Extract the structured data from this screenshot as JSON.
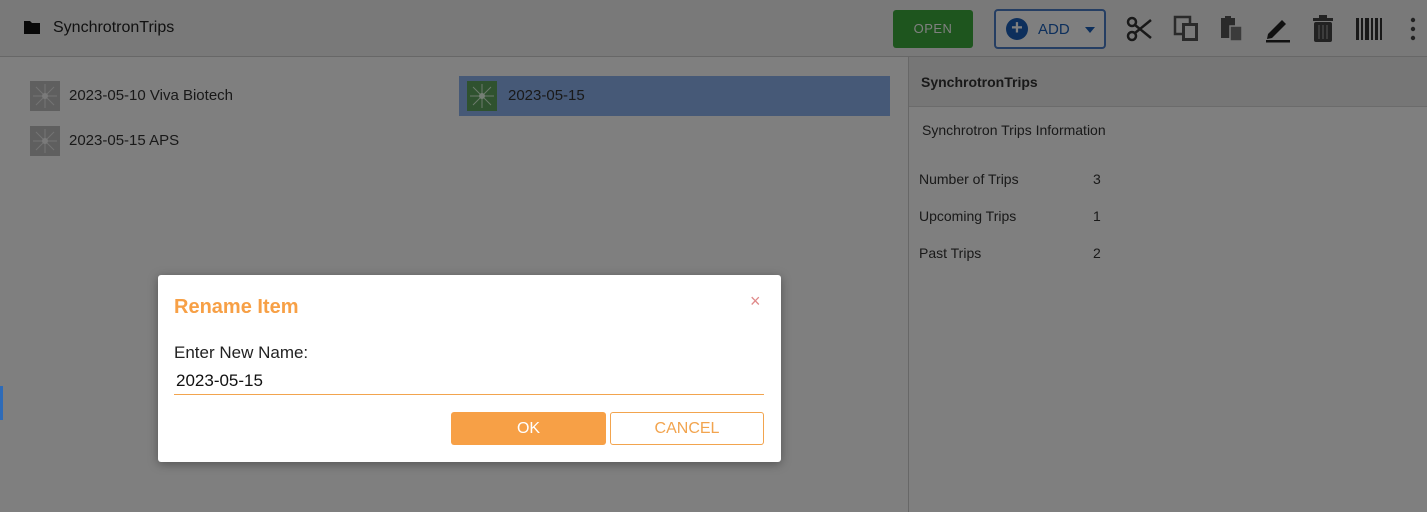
{
  "toolbar": {
    "title": "SynchrotronTrips",
    "open_label": "OPEN",
    "add_label": "ADD",
    "icons": [
      "folder-icon",
      "add-icon",
      "cut-icon",
      "copy-icon",
      "paste-icon",
      "rename-icon",
      "delete-icon",
      "barcode-icon",
      "more-icon"
    ]
  },
  "files": [
    {
      "label": "2023-05-10 Viva Biotech",
      "selected": false
    },
    {
      "label": "2023-05-15 APS",
      "selected": false
    },
    {
      "label": "2023-05-15",
      "selected": true
    }
  ],
  "info": {
    "header": "SynchrotronTrips",
    "subtitle": "Synchrotron Trips Information",
    "rows": [
      {
        "key": "Number of Trips",
        "value": "3"
      },
      {
        "key": "Upcoming Trips",
        "value": "1"
      },
      {
        "key": "Past Trips",
        "value": "2"
      }
    ]
  },
  "modal": {
    "title": "Rename Item",
    "close_glyph": "×",
    "prompt": "Enter New Name:",
    "input_value": "2023-05-15",
    "ok_label": "OK",
    "cancel_label": "CANCEL"
  },
  "colors": {
    "open_button": "#3dab3d",
    "add_accent": "#1b5fb8",
    "selection": "#8db3ee",
    "modal_accent": "#f7a046",
    "close_x": "#e08a8a"
  }
}
